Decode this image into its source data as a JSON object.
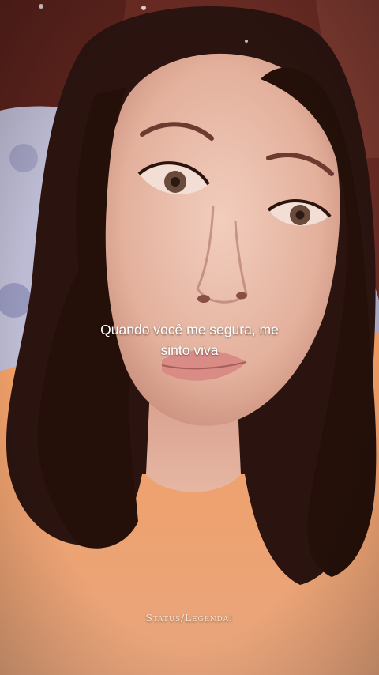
{
  "story": {
    "caption_lines": [
      "Quando você me segura, me",
      "sinto viva"
    ],
    "watermark": "Status/Legenda!"
  },
  "colors": {
    "shirt": "#f0a06e",
    "skin": "#e7bcaa",
    "hair": "#2a1410",
    "background_wall": "#6e2a22",
    "pillow": "#b9b7cf",
    "lips": "#d78c86"
  }
}
